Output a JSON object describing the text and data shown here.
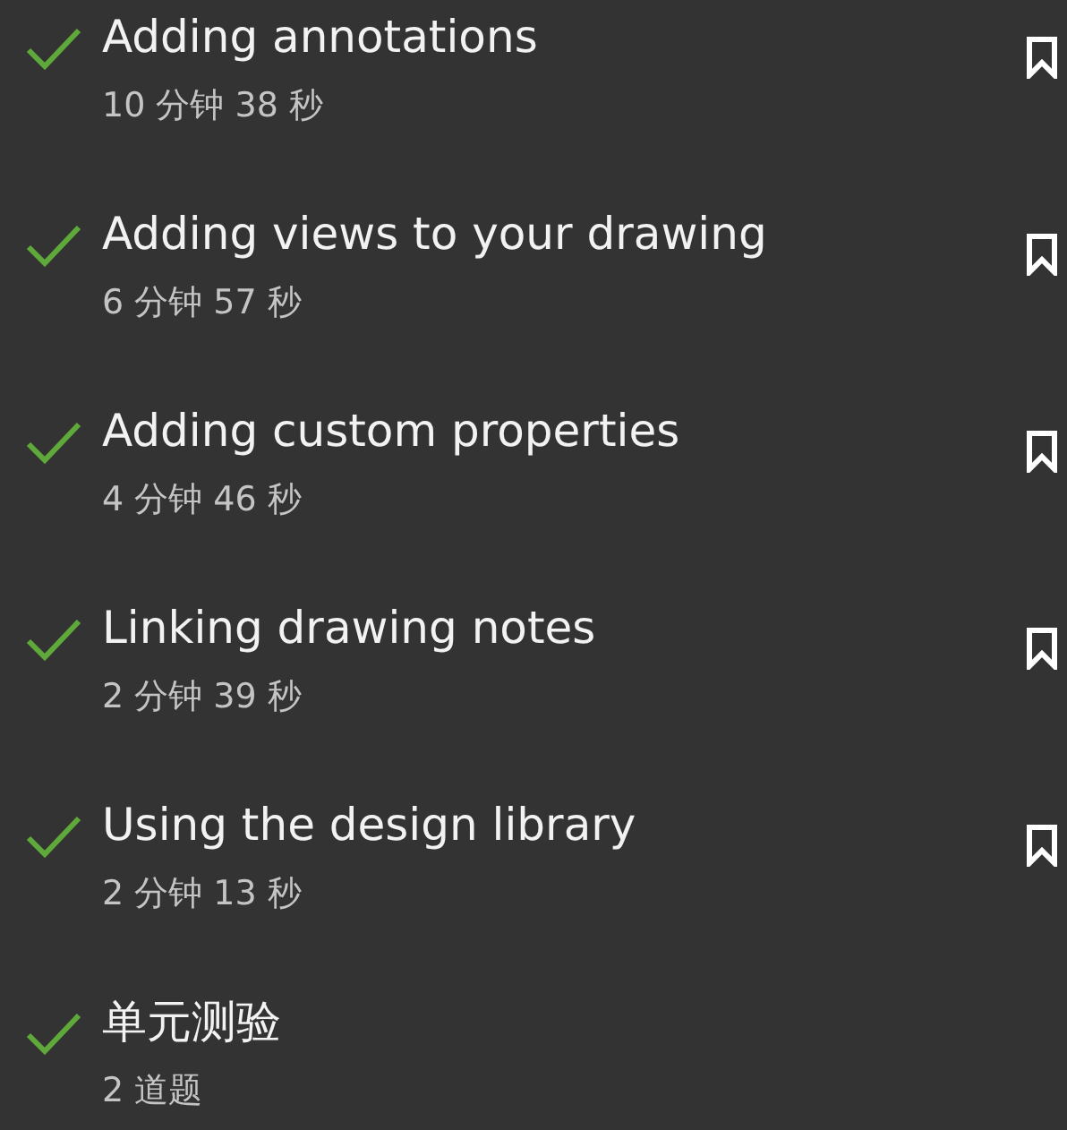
{
  "lessons": [
    {
      "title": "Adding annotations",
      "duration": "10 分钟 38 秒",
      "completed": true,
      "bookmark": true
    },
    {
      "title": "Adding views to your drawing",
      "duration": "6 分钟 57 秒",
      "completed": true,
      "bookmark": true
    },
    {
      "title": "Adding custom properties",
      "duration": "4 分钟 46 秒",
      "completed": true,
      "bookmark": true
    },
    {
      "title": "Linking drawing notes",
      "duration": "2 分钟 39 秒",
      "completed": true,
      "bookmark": true
    },
    {
      "title": "Using the design library",
      "duration": "2 分钟 13 秒",
      "completed": true,
      "bookmark": true
    },
    {
      "title": "单元测验",
      "duration": "2 道题",
      "completed": true,
      "bookmark": false
    }
  ]
}
